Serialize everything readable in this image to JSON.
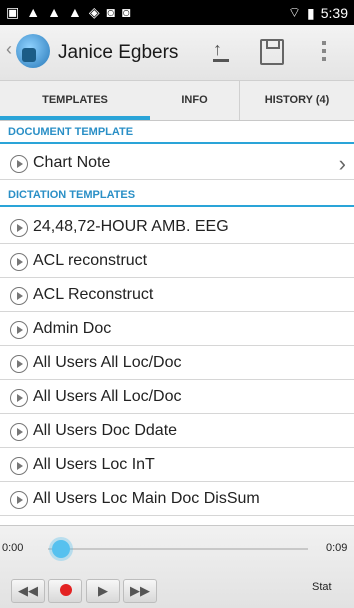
{
  "status": {
    "time": "5:39",
    "signal_icon": "signal-icon",
    "wifi_icon": "wifi-icon",
    "battery_icon": "battery-icon"
  },
  "header": {
    "title": "Janice Egbers"
  },
  "tabs": [
    "TEMPLATES",
    "INFO",
    "HISTORY (4)"
  ],
  "sections": {
    "document_template": "DOCUMENT TEMPLATE",
    "dictation_templates": "DICTATION TEMPLATES"
  },
  "document_template_item": "Chart Note",
  "dictation_items": [
    "24,48,72-HOUR AMB. EEG",
    "ACL reconstruct",
    "ACL Reconstruct",
    "Admin Doc",
    "All Users All Loc/Doc",
    "All Users All Loc/Doc",
    "All Users Doc Ddate",
    "All Users Loc InT",
    "All Users Loc Main Doc DisSum"
  ],
  "player": {
    "current_time": "0:00",
    "duration": "0:09",
    "progress": 0.0,
    "stat_label": "Stat"
  },
  "colors": {
    "accent": "#2aa4d8",
    "record": "#e32222"
  }
}
